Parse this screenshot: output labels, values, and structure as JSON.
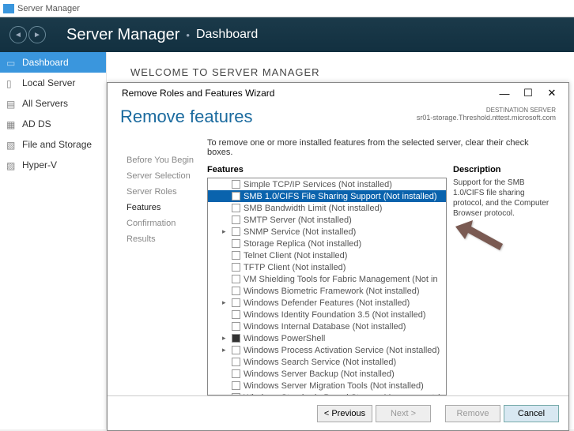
{
  "titlebar": "Server Manager",
  "header": {
    "app": "Server Manager",
    "page": "Dashboard"
  },
  "sidebar": {
    "items": [
      {
        "label": "Dashboard",
        "selected": true
      },
      {
        "label": "Local Server",
        "selected": false
      },
      {
        "label": "All Servers",
        "selected": false
      },
      {
        "label": "AD DS",
        "selected": false
      },
      {
        "label": "File and Storage",
        "selected": false
      },
      {
        "label": "Hyper-V",
        "selected": false
      }
    ]
  },
  "welcome": "WELCOME TO SERVER MANAGER",
  "dialog": {
    "title": "Remove Roles and Features Wizard",
    "heading": "Remove features",
    "destination_label": "DESTINATION SERVER",
    "destination_value": "sr01-storage.Threshold.nttest.microsoft.com",
    "instruction": "To remove one or more installed features from the selected server, clear their check boxes.",
    "steps": [
      {
        "label": "Before You Begin",
        "active": false
      },
      {
        "label": "Server Selection",
        "active": false
      },
      {
        "label": "Server Roles",
        "active": false
      },
      {
        "label": "Features",
        "active": true
      },
      {
        "label": "Confirmation",
        "active": false
      },
      {
        "label": "Results",
        "active": false
      }
    ],
    "features_header": "Features",
    "description_header": "Description",
    "description_text": "Support for the SMB 1.0/CIFS file sharing protocol, and the Computer Browser protocol.",
    "tree": [
      {
        "label": "Simple TCP/IP Services (Not installed)",
        "sel": false,
        "exp": ""
      },
      {
        "label": "SMB 1.0/CIFS File Sharing Support (Not installed)",
        "sel": true,
        "exp": ""
      },
      {
        "label": "SMB Bandwidth Limit (Not installed)",
        "sel": false,
        "exp": ""
      },
      {
        "label": "SMTP Server (Not installed)",
        "sel": false,
        "exp": ""
      },
      {
        "label": "SNMP Service (Not installed)",
        "sel": false,
        "exp": "▸"
      },
      {
        "label": "Storage Replica (Not installed)",
        "sel": false,
        "exp": ""
      },
      {
        "label": "Telnet Client (Not installed)",
        "sel": false,
        "exp": ""
      },
      {
        "label": "TFTP Client (Not installed)",
        "sel": false,
        "exp": ""
      },
      {
        "label": "VM Shielding Tools for Fabric Management (Not in",
        "sel": false,
        "exp": ""
      },
      {
        "label": "Windows Biometric Framework (Not installed)",
        "sel": false,
        "exp": ""
      },
      {
        "label": "Windows Defender Features (Not installed)",
        "sel": false,
        "exp": "▸"
      },
      {
        "label": "Windows Identity Foundation 3.5 (Not installed)",
        "sel": false,
        "exp": ""
      },
      {
        "label": "Windows Internal Database (Not installed)",
        "sel": false,
        "exp": ""
      },
      {
        "label": "Windows PowerShell",
        "sel": false,
        "exp": "▸",
        "checked": true
      },
      {
        "label": "Windows Process Activation Service (Not installed)",
        "sel": false,
        "exp": "▸"
      },
      {
        "label": "Windows Search Service (Not installed)",
        "sel": false,
        "exp": ""
      },
      {
        "label": "Windows Server Backup (Not installed)",
        "sel": false,
        "exp": ""
      },
      {
        "label": "Windows Server Migration Tools (Not installed)",
        "sel": false,
        "exp": ""
      },
      {
        "label": "Windows Standards-Based Storage Management (",
        "sel": false,
        "exp": ""
      }
    ],
    "buttons": {
      "previous": "< Previous",
      "next": "Next >",
      "remove": "Remove",
      "cancel": "Cancel"
    }
  }
}
